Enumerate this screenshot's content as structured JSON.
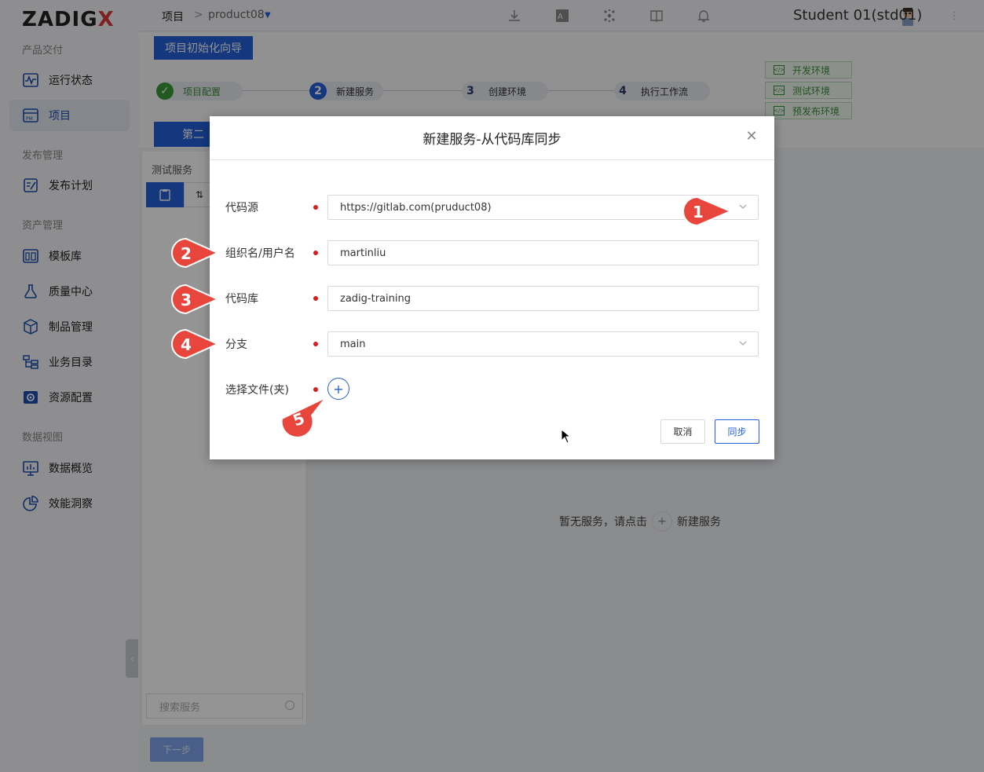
{
  "app": {
    "logo_text": "ZADIG",
    "logo_x": "X"
  },
  "sidebar": {
    "sections": [
      {
        "title": "产品交付"
      },
      {
        "title": "发布管理"
      },
      {
        "title": "资产管理"
      },
      {
        "title": "数据视图"
      }
    ],
    "items": [
      {
        "label": "运行状态",
        "icon": "pulse-icon"
      },
      {
        "label": "项目",
        "icon": "project-icon",
        "active": true
      },
      {
        "label": "发布计划",
        "icon": "release-plan-icon"
      },
      {
        "label": "模板库",
        "icon": "template-icon"
      },
      {
        "label": "质量中心",
        "icon": "flask-icon"
      },
      {
        "label": "制品管理",
        "icon": "package-icon"
      },
      {
        "label": "业务目录",
        "icon": "catalog-icon"
      },
      {
        "label": "资源配置",
        "icon": "settings-icon"
      },
      {
        "label": "数据概览",
        "icon": "dashboard-icon"
      },
      {
        "label": "效能洞察",
        "icon": "pie-chart-icon"
      }
    ]
  },
  "topbar": {
    "crumb_root": "项目",
    "crumb_sep": ">",
    "crumb_project": "product08",
    "user_name": "Student 01(std01)"
  },
  "wizard": {
    "button_label": "项目初始化向导",
    "steps": [
      {
        "num": "",
        "label": "项目配置",
        "state": "done"
      },
      {
        "num": "2",
        "label": "新建服务",
        "state": "active"
      },
      {
        "num": "3",
        "label": "创建环境",
        "state": "todo"
      },
      {
        "num": "4",
        "label": "执行工作流",
        "state": "todo"
      }
    ],
    "envs": [
      "开发环境",
      "测试环境",
      "预发布环境"
    ],
    "second_tab_label": "第二",
    "panel_title": "测试服务",
    "search_placeholder": "搜索服务",
    "next_label": "下一步",
    "empty_prefix": "暂无服务，请点击",
    "empty_suffix": "新建服务"
  },
  "modal": {
    "title": "新建服务-从代码库同步",
    "fields": {
      "source": {
        "label": "代码源",
        "value": "https://gitlab.com(pruduct08)"
      },
      "org": {
        "label": "组织名/用户名",
        "value": "martinliu"
      },
      "repo": {
        "label": "代码库",
        "value": "zadig-training"
      },
      "branch": {
        "label": "分支",
        "value": "main"
      },
      "files": {
        "label": "选择文件(夹)"
      }
    },
    "cancel_label": "取消",
    "sync_label": "同步"
  },
  "markers": [
    "1",
    "2",
    "3",
    "4",
    "5"
  ],
  "colors": {
    "accent": "#2460d8",
    "marker": "#e8453c",
    "env_green": "#3a8f3a",
    "required": "#d81e1e"
  }
}
